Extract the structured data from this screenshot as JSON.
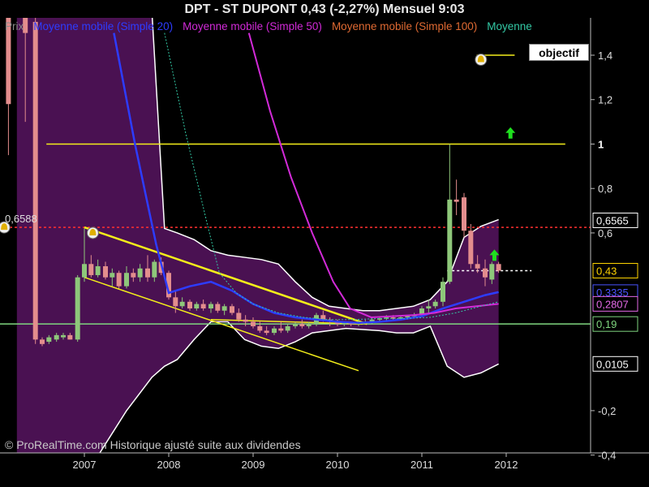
{
  "header": {
    "title": "DPT - ST DUPONT     0,43 (-2,27%)     Mensuel  9:03"
  },
  "legend": [
    {
      "label": "Prix",
      "color": "#8a8a8a"
    },
    {
      "label": "Moyenne mobile (Simple 20)",
      "color": "#2d3cff"
    },
    {
      "label": "Moyenne mobile (Simple 50)",
      "color": "#d22ad8"
    },
    {
      "label": "Moyenne mobile (Simple 100)",
      "color": "#e06a32"
    },
    {
      "label": "Moyenne",
      "color": "#33c9a5"
    }
  ],
  "copyright": "© ProRealTime.com Historique ajusté suite aux dividendes",
  "annotations": {
    "objectif": "objectif"
  },
  "colors": {
    "up_candle": "#8ec77a",
    "down_candle": "#e38d8d",
    "bollinger_fill": "#4a1152",
    "bollinger_border": "#ffffff",
    "sma20": "#2d3cff",
    "sma50": "#d22ad8",
    "sma100": "#33c9a5",
    "trendline": "#f3ee1a",
    "support_line": "#7fd67f",
    "resistance_dashed": "#ff3030"
  },
  "chart_data": {
    "type": "candlestick",
    "x_ticks": [
      "2007",
      "2008",
      "2009",
      "2010",
      "2011",
      "2012"
    ],
    "y_ticks": [
      "1,4",
      "1,2",
      "1",
      "0,8",
      "0,6",
      "0,43",
      "0,3335",
      "0,2807",
      "0,19",
      "0,0105",
      "-0,2",
      "-0,4"
    ],
    "ylim": [
      -0.4,
      1.5
    ],
    "price_labels": [
      {
        "text": "0,6565",
        "value": 0.6565,
        "side": "right",
        "bg": "#000000",
        "fg": "#ffffff"
      },
      {
        "text": "0,43",
        "value": 0.43,
        "side": "right",
        "bg": "#000000",
        "fg": "#ffd400"
      },
      {
        "text": "0,3335",
        "value": 0.3335,
        "side": "right",
        "bg": "#000000",
        "fg": "#4a53ff"
      },
      {
        "text": "0,2807",
        "value": 0.2807,
        "side": "right",
        "bg": "#000000",
        "fg": "#e56ae8"
      },
      {
        "text": "0,19",
        "value": 0.19,
        "side": "right",
        "bg": "#000000",
        "fg": "#7fd67f"
      },
      {
        "text": "0,0105",
        "value": 0.0105,
        "side": "right",
        "bg": "#000000",
        "fg": "#ffffff"
      },
      {
        "text": "0,6588",
        "value": 0.6588,
        "side": "left",
        "bg": "#000000",
        "fg": "#dddddd"
      }
    ],
    "horizontal_lines": [
      {
        "name": "objectif",
        "value": 1.4,
        "x_start": 2011.65,
        "x_end": 2012.1,
        "color": "#f3ee1a"
      },
      {
        "name": "resistance-1",
        "value": 1.0,
        "x_start": 2006.55,
        "x_end": 2012.7,
        "color": "#f3ee1a"
      },
      {
        "name": "resistance-dashed",
        "value": 0.625,
        "x_start": 2006.0,
        "x_end": 2013.0,
        "color": "#ff3030"
      },
      {
        "name": "support",
        "value": 0.19,
        "x_start": 2006.0,
        "x_end": 2013.0,
        "color": "#7fd67f"
      },
      {
        "name": "current-price",
        "value": 0.43,
        "x_start": 2011.3,
        "x_end": 2012.3,
        "color": "#ffffff"
      }
    ],
    "trendlines": [
      {
        "from": [
          2007.0,
          0.625
        ],
        "to": [
          2010.35,
          0.19
        ]
      },
      {
        "from": [
          2007.0,
          0.4
        ],
        "to": [
          2010.25,
          -0.02
        ]
      },
      {
        "from": [
          2008.5,
          0.21
        ],
        "to": [
          2010.3,
          0.19
        ]
      }
    ],
    "candles": [
      {
        "x": 2006.1,
        "open": 1.6,
        "high": 1.6,
        "low": 0.95,
        "close": 1.18
      },
      {
        "x": 2006.3,
        "open": 1.6,
        "high": 1.6,
        "low": 1.1,
        "close": 1.5
      },
      {
        "x": 2006.42,
        "open": 1.55,
        "high": 1.6,
        "low": 0.1,
        "close": 0.12
      },
      {
        "x": 2006.5,
        "open": 0.12,
        "high": 0.13,
        "low": 0.09,
        "close": 0.1
      },
      {
        "x": 2006.58,
        "open": 0.11,
        "high": 0.14,
        "low": 0.1,
        "close": 0.13
      },
      {
        "x": 2006.67,
        "open": 0.12,
        "high": 0.15,
        "low": 0.11,
        "close": 0.14
      },
      {
        "x": 2006.75,
        "open": 0.13,
        "high": 0.15,
        "low": 0.12,
        "close": 0.14
      },
      {
        "x": 2006.83,
        "open": 0.14,
        "high": 0.15,
        "low": 0.12,
        "close": 0.12
      },
      {
        "x": 2006.92,
        "open": 0.12,
        "high": 0.41,
        "low": 0.11,
        "close": 0.4
      },
      {
        "x": 2007.0,
        "open": 0.4,
        "high": 0.62,
        "low": 0.38,
        "close": 0.46
      },
      {
        "x": 2007.08,
        "open": 0.46,
        "high": 0.5,
        "low": 0.4,
        "close": 0.41
      },
      {
        "x": 2007.16,
        "open": 0.41,
        "high": 0.48,
        "low": 0.4,
        "close": 0.45
      },
      {
        "x": 2007.25,
        "open": 0.45,
        "high": 0.47,
        "low": 0.39,
        "close": 0.4
      },
      {
        "x": 2007.33,
        "open": 0.4,
        "high": 0.44,
        "low": 0.36,
        "close": 0.42
      },
      {
        "x": 2007.41,
        "open": 0.42,
        "high": 0.43,
        "low": 0.35,
        "close": 0.36
      },
      {
        "x": 2007.5,
        "open": 0.36,
        "high": 0.45,
        "low": 0.35,
        "close": 0.42
      },
      {
        "x": 2007.58,
        "open": 0.42,
        "high": 0.44,
        "low": 0.38,
        "close": 0.4
      },
      {
        "x": 2007.66,
        "open": 0.4,
        "high": 0.46,
        "low": 0.38,
        "close": 0.44
      },
      {
        "x": 2007.75,
        "open": 0.44,
        "high": 0.5,
        "low": 0.38,
        "close": 0.4
      },
      {
        "x": 2007.83,
        "open": 0.4,
        "high": 0.48,
        "low": 0.38,
        "close": 0.47
      },
      {
        "x": 2007.91,
        "open": 0.47,
        "high": 0.49,
        "low": 0.41,
        "close": 0.42
      },
      {
        "x": 2008.0,
        "open": 0.42,
        "high": 0.43,
        "low": 0.3,
        "close": 0.31
      },
      {
        "x": 2008.08,
        "open": 0.31,
        "high": 0.34,
        "low": 0.24,
        "close": 0.27
      },
      {
        "x": 2008.16,
        "open": 0.27,
        "high": 0.31,
        "low": 0.26,
        "close": 0.29
      },
      {
        "x": 2008.25,
        "open": 0.29,
        "high": 0.3,
        "low": 0.25,
        "close": 0.26
      },
      {
        "x": 2008.33,
        "open": 0.26,
        "high": 0.29,
        "low": 0.25,
        "close": 0.28
      },
      {
        "x": 2008.41,
        "open": 0.28,
        "high": 0.3,
        "low": 0.25,
        "close": 0.26
      },
      {
        "x": 2008.5,
        "open": 0.26,
        "high": 0.29,
        "low": 0.24,
        "close": 0.28
      },
      {
        "x": 2008.58,
        "open": 0.28,
        "high": 0.29,
        "low": 0.24,
        "close": 0.25
      },
      {
        "x": 2008.66,
        "open": 0.25,
        "high": 0.28,
        "low": 0.23,
        "close": 0.27
      },
      {
        "x": 2008.75,
        "open": 0.27,
        "high": 0.28,
        "low": 0.23,
        "close": 0.24
      },
      {
        "x": 2008.83,
        "open": 0.24,
        "high": 0.26,
        "low": 0.2,
        "close": 0.21
      },
      {
        "x": 2008.91,
        "open": 0.21,
        "high": 0.23,
        "low": 0.18,
        "close": 0.2
      },
      {
        "x": 2009.0,
        "open": 0.2,
        "high": 0.22,
        "low": 0.17,
        "close": 0.18
      },
      {
        "x": 2009.08,
        "open": 0.18,
        "high": 0.2,
        "low": 0.15,
        "close": 0.16
      },
      {
        "x": 2009.16,
        "open": 0.16,
        "high": 0.18,
        "low": 0.14,
        "close": 0.15
      },
      {
        "x": 2009.25,
        "open": 0.15,
        "high": 0.18,
        "low": 0.14,
        "close": 0.17
      },
      {
        "x": 2009.33,
        "open": 0.17,
        "high": 0.2,
        "low": 0.15,
        "close": 0.16
      },
      {
        "x": 2009.41,
        "open": 0.16,
        "high": 0.19,
        "low": 0.15,
        "close": 0.18
      },
      {
        "x": 2009.5,
        "open": 0.18,
        "high": 0.2,
        "low": 0.17,
        "close": 0.19
      },
      {
        "x": 2009.58,
        "open": 0.19,
        "high": 0.21,
        "low": 0.17,
        "close": 0.18
      },
      {
        "x": 2009.66,
        "open": 0.18,
        "high": 0.2,
        "low": 0.17,
        "close": 0.19
      },
      {
        "x": 2009.75,
        "open": 0.19,
        "high": 0.24,
        "low": 0.18,
        "close": 0.23
      },
      {
        "x": 2009.83,
        "open": 0.23,
        "high": 0.25,
        "low": 0.2,
        "close": 0.21
      },
      {
        "x": 2009.91,
        "open": 0.21,
        "high": 0.22,
        "low": 0.18,
        "close": 0.2
      },
      {
        "x": 2010.0,
        "open": 0.2,
        "high": 0.21,
        "low": 0.18,
        "close": 0.19
      },
      {
        "x": 2010.08,
        "open": 0.19,
        "high": 0.2,
        "low": 0.18,
        "close": 0.195
      },
      {
        "x": 2010.16,
        "open": 0.195,
        "high": 0.2,
        "low": 0.18,
        "close": 0.19
      },
      {
        "x": 2010.25,
        "open": 0.19,
        "high": 0.21,
        "low": 0.18,
        "close": 0.2
      },
      {
        "x": 2010.33,
        "open": 0.2,
        "high": 0.21,
        "low": 0.19,
        "close": 0.2
      },
      {
        "x": 2010.41,
        "open": 0.2,
        "high": 0.22,
        "low": 0.19,
        "close": 0.21
      },
      {
        "x": 2010.5,
        "open": 0.21,
        "high": 0.22,
        "low": 0.2,
        "close": 0.215
      },
      {
        "x": 2010.58,
        "open": 0.215,
        "high": 0.23,
        "low": 0.2,
        "close": 0.22
      },
      {
        "x": 2010.66,
        "open": 0.22,
        "high": 0.23,
        "low": 0.21,
        "close": 0.215
      },
      {
        "x": 2010.75,
        "open": 0.215,
        "high": 0.23,
        "low": 0.21,
        "close": 0.22
      },
      {
        "x": 2010.83,
        "open": 0.22,
        "high": 0.23,
        "low": 0.21,
        "close": 0.225
      },
      {
        "x": 2010.91,
        "open": 0.225,
        "high": 0.24,
        "low": 0.22,
        "close": 0.23
      },
      {
        "x": 2011.0,
        "open": 0.23,
        "high": 0.27,
        "low": 0.22,
        "close": 0.26
      },
      {
        "x": 2011.08,
        "open": 0.26,
        "high": 0.3,
        "low": 0.24,
        "close": 0.27
      },
      {
        "x": 2011.16,
        "open": 0.27,
        "high": 0.3,
        "low": 0.26,
        "close": 0.29
      },
      {
        "x": 2011.25,
        "open": 0.29,
        "high": 0.4,
        "low": 0.27,
        "close": 0.38
      },
      {
        "x": 2011.33,
        "open": 0.38,
        "high": 1.0,
        "low": 0.37,
        "close": 0.75
      },
      {
        "x": 2011.41,
        "open": 0.75,
        "high": 0.84,
        "low": 0.68,
        "close": 0.74
      },
      {
        "x": 2011.5,
        "open": 0.76,
        "high": 0.78,
        "low": 0.58,
        "close": 0.61
      },
      {
        "x": 2011.58,
        "open": 0.61,
        "high": 0.64,
        "low": 0.44,
        "close": 0.46
      },
      {
        "x": 2011.66,
        "open": 0.46,
        "high": 0.5,
        "low": 0.42,
        "close": 0.44
      },
      {
        "x": 2011.75,
        "open": 0.44,
        "high": 0.48,
        "low": 0.36,
        "close": 0.4
      },
      {
        "x": 2011.83,
        "open": 0.39,
        "high": 0.47,
        "low": 0.37,
        "close": 0.46
      },
      {
        "x": 2011.91,
        "open": 0.46,
        "high": 0.47,
        "low": 0.42,
        "close": 0.43
      }
    ],
    "series": [
      {
        "name": "Moyenne mobile (Simple 20)",
        "color": "#2d3cff",
        "width": 2.5,
        "points": [
          [
            2007.35,
            1.5
          ],
          [
            2007.6,
            1.0
          ],
          [
            2007.85,
            0.55
          ],
          [
            2008.0,
            0.33
          ],
          [
            2008.25,
            0.36
          ],
          [
            2008.5,
            0.38
          ],
          [
            2008.75,
            0.34
          ],
          [
            2009.0,
            0.28
          ],
          [
            2009.25,
            0.24
          ],
          [
            2009.5,
            0.22
          ],
          [
            2009.75,
            0.21
          ],
          [
            2010.0,
            0.2
          ],
          [
            2010.25,
            0.195
          ],
          [
            2010.5,
            0.2
          ],
          [
            2010.75,
            0.21
          ],
          [
            2011.0,
            0.225
          ],
          [
            2011.25,
            0.26
          ],
          [
            2011.5,
            0.29
          ],
          [
            2011.75,
            0.32
          ],
          [
            2011.91,
            0.3335
          ]
        ]
      },
      {
        "name": "Moyenne mobile (Simple 50)",
        "color": "#d22ad8",
        "width": 2,
        "points": [
          [
            2008.95,
            1.5
          ],
          [
            2009.2,
            1.15
          ],
          [
            2009.45,
            0.85
          ],
          [
            2009.7,
            0.6
          ],
          [
            2009.95,
            0.38
          ],
          [
            2010.15,
            0.26
          ],
          [
            2010.4,
            0.22
          ],
          [
            2010.65,
            0.225
          ],
          [
            2010.9,
            0.23
          ],
          [
            2011.15,
            0.24
          ],
          [
            2011.4,
            0.26
          ],
          [
            2011.65,
            0.27
          ],
          [
            2011.91,
            0.2807
          ]
        ]
      },
      {
        "name": "Moyenne",
        "color": "#33c9a5",
        "width": 1,
        "dashed": true,
        "points": [
          [
            2007.95,
            1.5
          ],
          [
            2008.2,
            1.05
          ],
          [
            2008.45,
            0.65
          ],
          [
            2008.6,
            0.42
          ],
          [
            2008.8,
            0.33
          ],
          [
            2009.0,
            0.28
          ],
          [
            2009.3,
            0.24
          ],
          [
            2009.6,
            0.22
          ],
          [
            2009.9,
            0.21
          ],
          [
            2010.2,
            0.21
          ],
          [
            2010.5,
            0.215
          ],
          [
            2010.8,
            0.215
          ],
          [
            2011.1,
            0.22
          ],
          [
            2011.4,
            0.24
          ],
          [
            2011.7,
            0.27
          ],
          [
            2011.91,
            0.29
          ]
        ]
      }
    ],
    "bollinger": {
      "upper": [
        [
          2006.2,
          1.6
        ],
        [
          2006.5,
          1.6
        ],
        [
          2007.0,
          1.6
        ],
        [
          2007.5,
          1.6
        ],
        [
          2007.8,
          1.6
        ],
        [
          2007.95,
          0.62
        ],
        [
          2008.1,
          0.6
        ],
        [
          2008.3,
          0.57
        ],
        [
          2008.5,
          0.52
        ],
        [
          2008.7,
          0.5
        ],
        [
          2008.9,
          0.49
        ],
        [
          2009.1,
          0.48
        ],
        [
          2009.3,
          0.46
        ],
        [
          2009.5,
          0.38
        ],
        [
          2009.7,
          0.31
        ],
        [
          2009.9,
          0.27
        ],
        [
          2010.1,
          0.26
        ],
        [
          2010.3,
          0.25
        ],
        [
          2010.5,
          0.25
        ],
        [
          2010.7,
          0.26
        ],
        [
          2010.9,
          0.27
        ],
        [
          2011.1,
          0.3
        ],
        [
          2011.3,
          0.38
        ],
        [
          2011.5,
          0.58
        ],
        [
          2011.7,
          0.63
        ],
        [
          2011.91,
          0.66
        ]
      ],
      "lower": [
        [
          2006.2,
          -0.5
        ],
        [
          2006.5,
          -0.5
        ],
        [
          2007.0,
          -0.5
        ],
        [
          2007.5,
          -0.2
        ],
        [
          2007.8,
          -0.05
        ],
        [
          2007.95,
          0.0
        ],
        [
          2008.1,
          0.03
        ],
        [
          2008.3,
          0.12
        ],
        [
          2008.5,
          0.2
        ],
        [
          2008.7,
          0.2
        ],
        [
          2008.9,
          0.12
        ],
        [
          2009.1,
          0.09
        ],
        [
          2009.3,
          0.08
        ],
        [
          2009.5,
          0.11
        ],
        [
          2009.7,
          0.15
        ],
        [
          2009.9,
          0.16
        ],
        [
          2010.1,
          0.17
        ],
        [
          2010.3,
          0.165
        ],
        [
          2010.5,
          0.16
        ],
        [
          2010.7,
          0.15
        ],
        [
          2010.9,
          0.15
        ],
        [
          2011.1,
          0.18
        ],
        [
          2011.3,
          0.0
        ],
        [
          2011.5,
          -0.05
        ],
        [
          2011.7,
          -0.03
        ],
        [
          2011.91,
          0.01
        ]
      ]
    },
    "markers": [
      {
        "type": "alarm",
        "x": 2006.05,
        "value": 0.625
      },
      {
        "type": "alarm",
        "x": 2007.1,
        "value": 0.6
      },
      {
        "type": "alarm",
        "x": 2011.7,
        "value": 1.38
      },
      {
        "type": "up-arrow",
        "x": 2012.05,
        "value": 1.05
      },
      {
        "type": "up-arrow",
        "x": 2011.86,
        "value": 0.5
      }
    ]
  }
}
